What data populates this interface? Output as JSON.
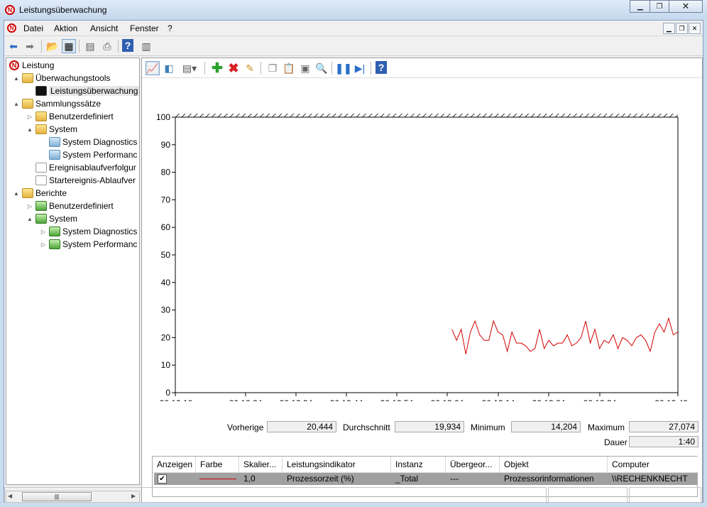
{
  "window": {
    "title": "Leistungsüberwachung"
  },
  "menu": [
    "Datei",
    "Aktion",
    "Ansicht",
    "Fenster",
    "?"
  ],
  "tree": [
    {
      "label": "Leistung",
      "level": 0,
      "expander": "",
      "icon": "perf-logo-icon"
    },
    {
      "label": "Überwachungstools",
      "level": 1,
      "expander": "▲",
      "icon": "folder-icon"
    },
    {
      "label": "Leistungsüberwachung",
      "level": 2,
      "expander": "",
      "icon": "perfmon-icon"
    },
    {
      "label": "Sammlungssätze",
      "level": 1,
      "expander": "▲",
      "icon": "folder-icon"
    },
    {
      "label": "Benutzerdefiniert",
      "level": 2,
      "expander": "▷",
      "icon": "folder-icon"
    },
    {
      "label": "System",
      "level": 2,
      "expander": "▲",
      "icon": "folder-icon"
    },
    {
      "label": "System Diagnostics",
      "level": 3,
      "expander": "",
      "icon": "dataset-icon"
    },
    {
      "label": "System Performanc",
      "level": 3,
      "expander": "",
      "icon": "dataset-icon"
    },
    {
      "label": "Ereignisablaufverfolgur",
      "level": 2,
      "expander": "",
      "icon": "doc-icon"
    },
    {
      "label": "Startereignis-Ablaufver",
      "level": 2,
      "expander": "",
      "icon": "doc-icon"
    },
    {
      "label": "Berichte",
      "level": 1,
      "expander": "▲",
      "icon": "folder-icon"
    },
    {
      "label": "Benutzerdefiniert",
      "level": 2,
      "expander": "▷",
      "icon": "report-icon"
    },
    {
      "label": "System",
      "level": 2,
      "expander": "▲",
      "icon": "report-icon"
    },
    {
      "label": "System Diagnostics",
      "level": 3,
      "expander": "▷",
      "icon": "report-icon"
    },
    {
      "label": "System Performanc",
      "level": 3,
      "expander": "▷",
      "icon": "report-icon"
    }
  ],
  "chart_data": {
    "type": "line",
    "ylim": [
      0,
      100
    ],
    "yticks": [
      0,
      10,
      20,
      30,
      40,
      50,
      60,
      70,
      80,
      90,
      100
    ],
    "xticks": [
      "20:12:10",
      "20:12:24",
      "20:12:34",
      "20:12:44",
      "20:12:54",
      "20:13:04",
      "20:13:14",
      "20:13:24",
      "20:13:34",
      "20:13:49"
    ],
    "series": [
      {
        "color": "#d40000",
        "x": [
          60,
          61,
          62,
          63,
          64,
          65,
          66,
          67,
          68,
          69,
          70,
          71,
          72,
          73,
          74,
          75,
          76,
          77,
          78,
          79,
          80,
          81,
          82,
          83,
          84,
          85,
          86,
          87,
          88,
          89,
          90,
          91,
          92,
          93,
          94,
          95,
          96,
          97,
          98,
          99,
          100
        ],
        "values": [
          23,
          19,
          23,
          14,
          22,
          26,
          21,
          19,
          19,
          26,
          22,
          21,
          15,
          22,
          18,
          18,
          17,
          15,
          16,
          23,
          16,
          19,
          17,
          18,
          18,
          21,
          17,
          18,
          20,
          26,
          18,
          23,
          16,
          19,
          18,
          21,
          16,
          20,
          19,
          17,
          20
        ]
      }
    ],
    "x_extra": [
      101,
      102,
      103,
      104,
      105,
      106,
      107,
      108,
      109
    ],
    "values_extra": [
      21,
      19,
      15,
      22,
      25,
      22,
      27,
      21,
      22
    ]
  },
  "stats": {
    "prev_label": "Vorherige",
    "prev": "20,444",
    "avg_label": "Durchschnitt",
    "avg": "19,934",
    "min_label": "Minimum",
    "min": "14,204",
    "max_label": "Maximum",
    "max": "27,074",
    "dur_label": "Dauer",
    "dur": "1:40"
  },
  "counters": {
    "headers": [
      "Anzeigen",
      "Farbe",
      "Skalier...",
      "Leistungsindikator",
      "Instanz",
      "Übergeor...",
      "Objekt",
      "Computer"
    ],
    "row": {
      "show": "✔",
      "scale": "1,0",
      "counter": "Prozessorzeit (%)",
      "instance": "_Total",
      "parent": "---",
      "object": "Prozessorinformationen",
      "computer": "\\\\RECHENKNECHT",
      "color": "#d40000"
    }
  }
}
